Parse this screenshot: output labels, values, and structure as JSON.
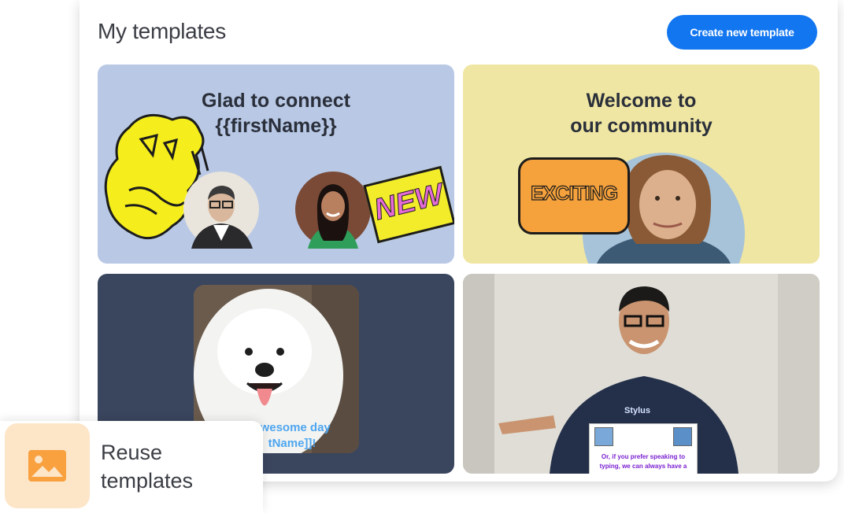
{
  "header": {
    "title": "My templates",
    "create_button": "Create new template"
  },
  "templates": [
    {
      "headline_lines": [
        "Glad to connect",
        "{{firstName}}"
      ],
      "sticker_text": "NEW",
      "background": "#b8c8e5"
    },
    {
      "headline_lines": [
        "Welcome to",
        "our community"
      ],
      "sticker_text": "EXCITING",
      "background": "#f0e6a3"
    },
    {
      "caption_lines": [
        "awesome day",
        "tName]]!"
      ],
      "background": "#3a455e"
    },
    {
      "hoodie_text": "Stylus",
      "sign_lines": [
        "Or, if you prefer speaking to",
        "typing, we can always have a"
      ],
      "background": "#d8d6cf"
    }
  ],
  "feature": {
    "label_lines": [
      "Reuse",
      "templates"
    ],
    "icon": "image-icon"
  },
  "colors": {
    "accent": "#1276f0",
    "feature_tile": "#fde5c8",
    "feature_icon": "#f9a03f"
  }
}
